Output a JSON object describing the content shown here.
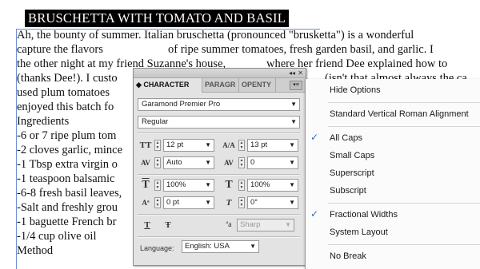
{
  "document": {
    "headline": "BRUSCHETTA WITH TOMATO AND BASIL",
    "lines": [
      {
        "a": "Ah, the bounty of summer. Italian bruschetta (pronounced \"brusketta\") is a wonderful",
        "b": ""
      },
      {
        "a": "capture the flavors",
        "b": "of ripe summer tomatoes, fresh garden basil, and garlic. I"
      },
      {
        "a": "the other night at my friend Suzanne's house,",
        "b": "where her friend Dee explained how to"
      },
      {
        "a": "(thanks Dee!). I custo",
        "b": ""
      },
      {
        "a": "used plum tomatoes",
        "b": ""
      },
      {
        "a": "enjoyed this batch fo",
        "b": ""
      },
      {
        "a": "Ingredients",
        "b": ""
      },
      {
        "a": "-6 or 7 ripe plum tom",
        "b": ""
      },
      {
        "a": "-2 cloves garlic, mince",
        "b": ""
      },
      {
        "a": "-1 Tbsp extra virgin o",
        "b": ""
      },
      {
        "a": "-1 teaspoon balsamic",
        "b": ""
      },
      {
        "a": "-6-8 fresh basil leaves,",
        "b": ""
      },
      {
        "a": "-Salt and freshly grou",
        "b": ""
      },
      {
        "a": "-1 baguette French br",
        "b": ""
      },
      {
        "a": "-1/4 cup olive oil",
        "b": ""
      },
      {
        "a": "Method",
        "b": ""
      }
    ],
    "partial_line_3_tail": "(isn't that almost always the ca"
  },
  "panel": {
    "collapse_glyph": "◂◂",
    "close_glyph": "✕",
    "tabs": [
      {
        "label": "◆ CHARACTER"
      },
      {
        "label": "PARAGR"
      },
      {
        "label": "OPENTY"
      }
    ],
    "menu_glyph": "▾≡",
    "font_family": "Garamond Premier Pro",
    "font_style": "Regular",
    "font_size": "12 pt",
    "leading": "13 pt",
    "kerning": "Auto",
    "tracking": "0",
    "vertical_scale": "100%",
    "horizontal_scale": "100%",
    "baseline_shift": "0 pt",
    "skew": "0°",
    "antialias": "Sharp",
    "language_label": "Language:",
    "language": "English: USA",
    "icons": {
      "font_size": "TT",
      "leading": "A/A",
      "kerning": "AV",
      "tracking": "AV",
      "vscale": "T",
      "hscale": "T",
      "baseline": "Aª",
      "skew": "T",
      "underline": "T",
      "strike": "Ŧ",
      "aa": "ªa"
    }
  },
  "menu": {
    "items": [
      {
        "label": "Hide Options",
        "checked": false
      },
      {
        "label": "Standard Vertical Roman Alignment",
        "checked": false
      },
      {
        "label": "All Caps",
        "checked": true
      },
      {
        "label": "Small Caps",
        "checked": false
      },
      {
        "label": "Superscript",
        "checked": false
      },
      {
        "label": "Subscript",
        "checked": false
      },
      {
        "label": "Fractional Widths",
        "checked": true
      },
      {
        "label": "System Layout",
        "checked": false
      },
      {
        "label": "No Break",
        "checked": false
      }
    ],
    "check_glyph": "✓"
  }
}
